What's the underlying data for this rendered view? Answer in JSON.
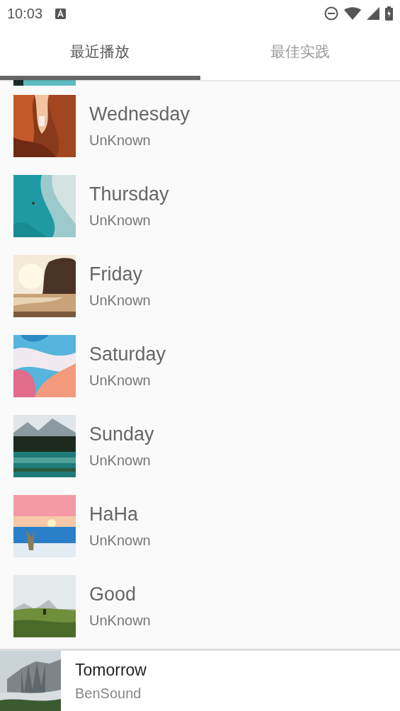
{
  "status_bar": {
    "time": "10:03"
  },
  "tabs": [
    {
      "label": "最近播放",
      "selected": true
    },
    {
      "label": "最佳实践",
      "selected": false
    }
  ],
  "songs": [
    {
      "title": "Wednesday",
      "artist": "UnKnown"
    },
    {
      "title": "Thursday",
      "artist": "UnKnown"
    },
    {
      "title": "Friday",
      "artist": "UnKnown"
    },
    {
      "title": "Saturday",
      "artist": "UnKnown"
    },
    {
      "title": "Sunday",
      "artist": "UnKnown"
    },
    {
      "title": "HaHa",
      "artist": "UnKnown"
    },
    {
      "title": "Good",
      "artist": "UnKnown"
    }
  ],
  "now_playing": {
    "title": "Tomorrow",
    "artist": "BenSound"
  }
}
